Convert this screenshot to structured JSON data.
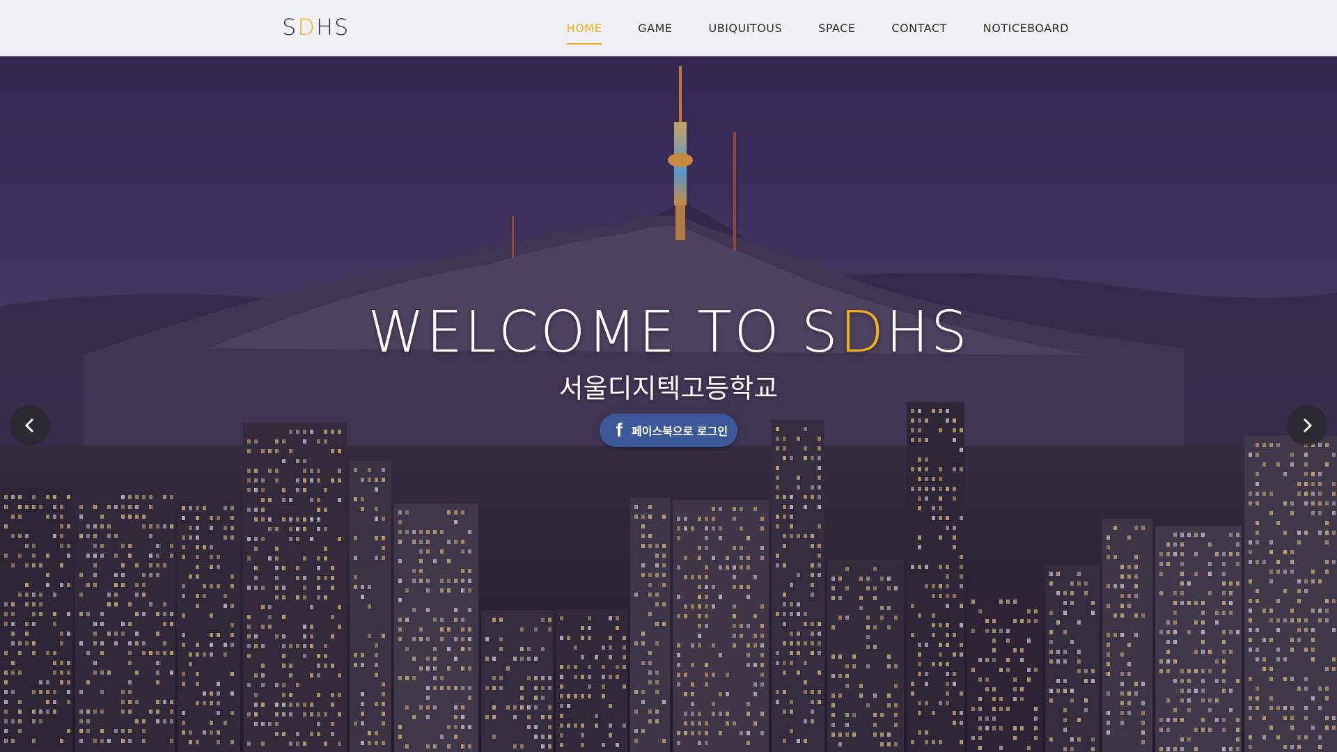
{
  "brand": {
    "logo_prefix": "S",
    "logo_accent": "D",
    "logo_suffix": "HS"
  },
  "nav": {
    "items": [
      {
        "label": "HOME",
        "active": true
      },
      {
        "label": "GAME",
        "active": false
      },
      {
        "label": "UBIQUITOUS",
        "active": false
      },
      {
        "label": "SPACE",
        "active": false
      },
      {
        "label": "CONTACT",
        "active": false
      },
      {
        "label": "NOTICEBOARD",
        "active": false
      }
    ]
  },
  "hero": {
    "title_prefix": "WELCOME TO S",
    "title_accent": "D",
    "title_suffix": "HS",
    "subtitle": "서울디지텍고등학교",
    "facebook_button": {
      "icon": "f",
      "label": "페이스북으로 로그인"
    },
    "prev_icon": "‹",
    "next_icon": "›"
  },
  "colors": {
    "accent": "#f2b01e",
    "facebook": "#3b5998",
    "navbar_bg": "#f1f1f3"
  }
}
